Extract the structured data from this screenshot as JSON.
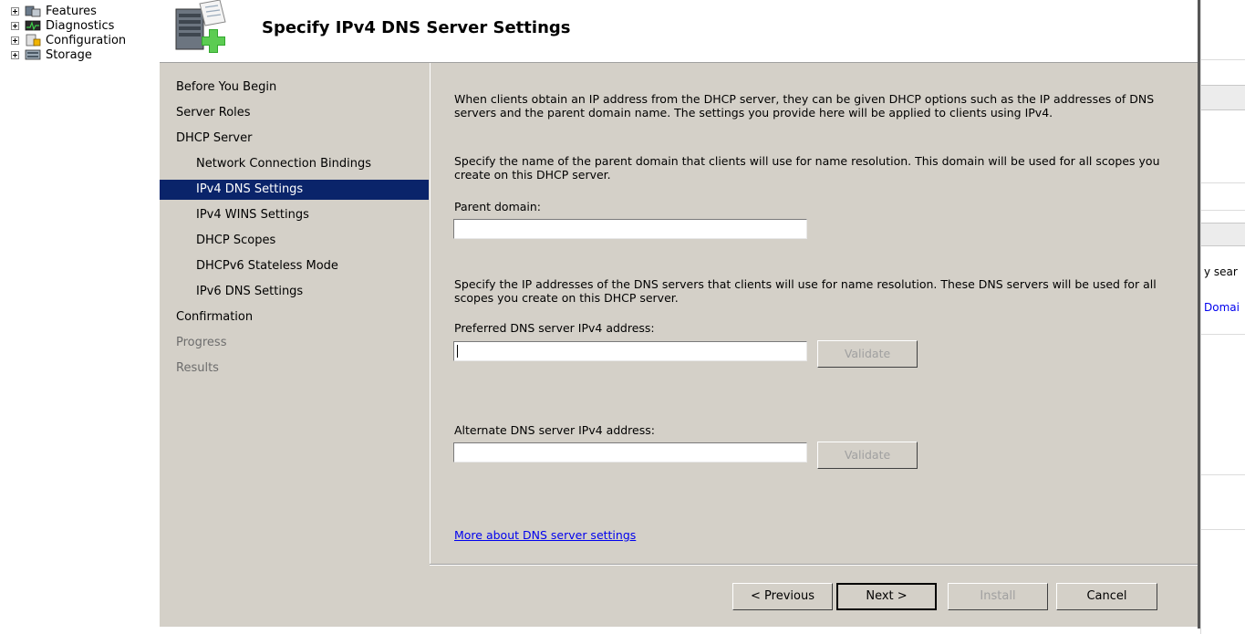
{
  "tree": {
    "items": [
      {
        "label": "Features",
        "icon": "features-icon"
      },
      {
        "label": "Diagnostics",
        "icon": "diagnostics-icon"
      },
      {
        "label": "Configuration",
        "icon": "configuration-icon"
      },
      {
        "label": "Storage",
        "icon": "storage-icon"
      }
    ]
  },
  "right_pane": {
    "partial_text_1": "y sear",
    "partial_link": "Domai"
  },
  "wizard": {
    "title": "Specify IPv4 DNS Server Settings",
    "icon": "server-add-icon",
    "nav": [
      {
        "label": "Before You Begin",
        "level": 0,
        "state": "normal"
      },
      {
        "label": "Server Roles",
        "level": 0,
        "state": "normal"
      },
      {
        "label": "DHCP Server",
        "level": 0,
        "state": "normal"
      },
      {
        "label": "Network Connection Bindings",
        "level": 1,
        "state": "normal"
      },
      {
        "label": "IPv4 DNS Settings",
        "level": 1,
        "state": "selected"
      },
      {
        "label": "IPv4 WINS Settings",
        "level": 1,
        "state": "normal"
      },
      {
        "label": "DHCP Scopes",
        "level": 1,
        "state": "normal"
      },
      {
        "label": "DHCPv6 Stateless Mode",
        "level": 1,
        "state": "normal"
      },
      {
        "label": "IPv6 DNS Settings",
        "level": 1,
        "state": "normal"
      },
      {
        "label": "Confirmation",
        "level": 0,
        "state": "normal"
      },
      {
        "label": "Progress",
        "level": 0,
        "state": "disabled"
      },
      {
        "label": "Results",
        "level": 0,
        "state": "disabled"
      }
    ],
    "intro": "When clients obtain an IP address from the DHCP server, they can be given DHCP options such as the IP addresses of DNS servers and the parent domain name. The settings you provide here will be applied to clients using IPv4.",
    "domain_instructions": "Specify the name of the parent domain that clients will use for name resolution. This domain will be used for all scopes you create on this DHCP server.",
    "parent_domain_label": "Parent domain:",
    "parent_domain_value": "",
    "dns_instructions": "Specify the IP addresses of the DNS servers that clients will use for name resolution. These DNS servers will be used for all scopes you create on this DHCP server.",
    "preferred_label": "Preferred DNS server IPv4 address:",
    "preferred_value": "",
    "alternate_label": "Alternate DNS server IPv4 address:",
    "alternate_value": "",
    "validate_label": "Validate",
    "more_link": "More about DNS server settings",
    "buttons": {
      "previous": "< Previous",
      "next": "Next >",
      "install": "Install",
      "cancel": "Cancel"
    }
  },
  "colors": {
    "selected_bg": "#0a246a",
    "dialog_bg": "#d4d0c8",
    "link": "#0000ee"
  }
}
